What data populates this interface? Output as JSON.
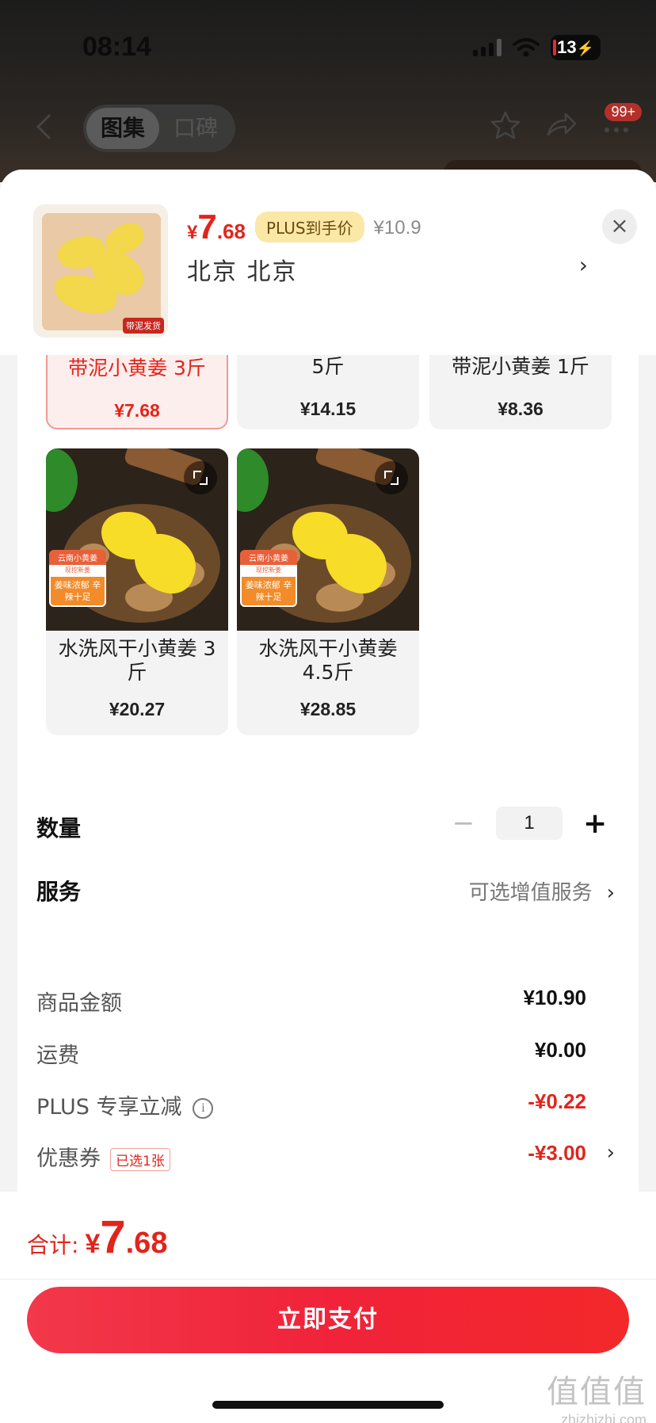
{
  "status_bar": {
    "time": "08:14",
    "battery": "13"
  },
  "nav": {
    "tabs": [
      {
        "label": "图集"
      },
      {
        "label": "口碑"
      }
    ],
    "badge": "99+"
  },
  "header": {
    "yen": "¥",
    "price_int": "7",
    "price_dec": ".68",
    "plus_tag": "PLUS到手价",
    "original_price": "¥10.9",
    "address": "北京  北京",
    "address_chevron": "›",
    "thumb_tag": "带泥发货",
    "close": "×"
  },
  "options": [
    {
      "name": "带泥小黄姜 3斤",
      "price": "¥7.68",
      "selected": true
    },
    {
      "name": "5斤",
      "price": "¥14.15",
      "selected": false
    },
    {
      "name": "带泥小黄姜 1斤",
      "price": "¥8.36",
      "selected": false
    },
    {
      "name": "水洗风干小黄姜 3斤",
      "price": "¥20.27",
      "selected": false,
      "img_labels": [
        "云南小黄姜",
        "现挖新姜",
        "姜味浓郁 辛辣十足"
      ]
    },
    {
      "name": "水洗风干小黄姜 4.5斤",
      "price": "¥28.85",
      "selected": false,
      "img_labels": [
        "云南小黄姜",
        "现挖新姜",
        "姜味浓郁 辛辣十足"
      ]
    }
  ],
  "quantity": {
    "label": "数量",
    "minus": "−",
    "value": "1",
    "plus": "+"
  },
  "service": {
    "label": "服务",
    "value": "可选增值服务",
    "chevron": "›"
  },
  "summary": {
    "goods_label": "商品金额",
    "goods_value": "¥10.90",
    "shipping_label": "运费",
    "shipping_value": "¥0.00",
    "plus_label": "PLUS 专享立减",
    "plus_info": "i",
    "plus_value": "-¥0.22",
    "coupon_label": "优惠券",
    "coupon_tag": "已选1张",
    "coupon_value": "-¥3.00",
    "coupon_chevron": "›"
  },
  "footer": {
    "total_label": "合计:",
    "total_yen": "¥",
    "total_int": "7",
    "total_dec": ".68",
    "pay_button": "立即支付"
  },
  "watermark": {
    "big": "值值值",
    "small": "zhizhizhi.com"
  },
  "colors": {
    "accent": "#e1251b",
    "plus_tag_bg": "#fbe7a6",
    "pay_button": "#f0233a"
  }
}
